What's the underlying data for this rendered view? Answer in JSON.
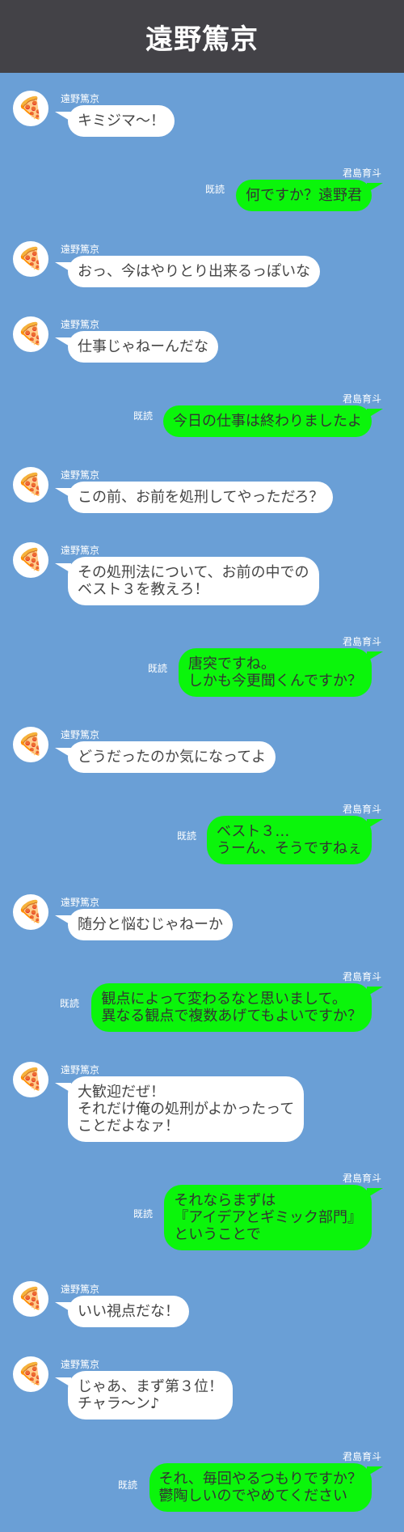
{
  "header": {
    "title": "遠野篤京"
  },
  "contacts": {
    "left_name": "遠野篤京",
    "right_name": "君島育斗",
    "left_avatar_icon": "🍕"
  },
  "read_label": "既読",
  "messages": [
    {
      "side": "in",
      "text": "キミジマ〜！"
    },
    {
      "side": "out",
      "text": "何ですか？遠野君"
    },
    {
      "side": "in",
      "text": "おっ、今はやりとり出来るっぽいな"
    },
    {
      "side": "in",
      "text": "仕事じゃねーんだな"
    },
    {
      "side": "out",
      "text": "今日の仕事は終わりましたよ"
    },
    {
      "side": "in",
      "text": "この前、お前を処刑してやっただろ？"
    },
    {
      "side": "in",
      "text": "その処刑法について、お前の中での\nベスト３を教えろ！"
    },
    {
      "side": "out",
      "text": "唐突ですね。\nしかも今更聞くんですか？"
    },
    {
      "side": "in",
      "text": "どうだったのか気になってよ"
    },
    {
      "side": "out",
      "text": "ベスト３…\nうーん、そうですねぇ"
    },
    {
      "side": "in",
      "text": "随分と悩むじゃねーか"
    },
    {
      "side": "out",
      "text": "観点によって変わるなと思いまして。\n異なる観点で複数あげてもよいですか？"
    },
    {
      "side": "in",
      "text": "大歓迎だぜ！\nそれだけ俺の処刑がよかったって\nことだよなァ！"
    },
    {
      "side": "out",
      "text": "それならまずは\n『アイデアとギミック部門』\nということで"
    },
    {
      "side": "in",
      "text": "いい視点だな！"
    },
    {
      "side": "in",
      "text": "じゃあ、まず第３位！\nチャラ〜ン♪"
    },
    {
      "side": "out",
      "text": "それ、毎回やるつもりですか？\n鬱陶しいのでやめてください"
    }
  ]
}
